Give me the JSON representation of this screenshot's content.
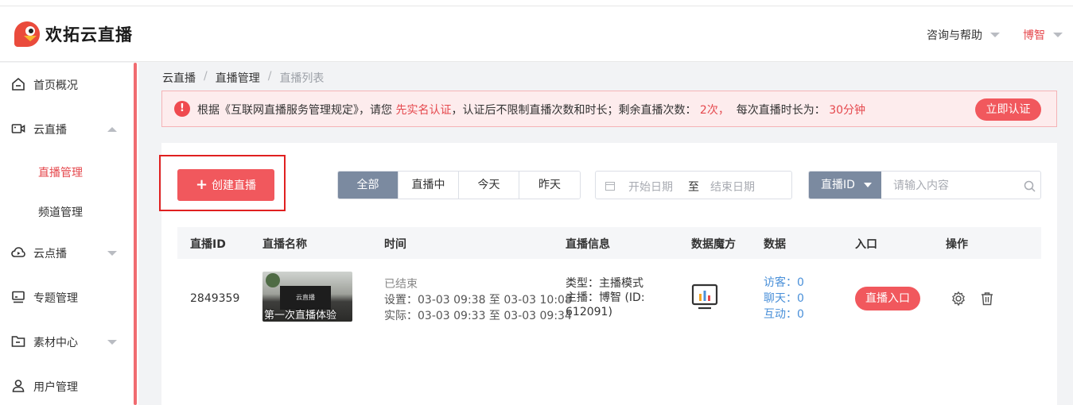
{
  "brand": {
    "name": "欢拓云直播",
    "accent": "#f1585d"
  },
  "header": {
    "help_label": "咨询与帮助",
    "user_name": "博智"
  },
  "sidebar": {
    "items": [
      {
        "label": "首页概况",
        "icon": "home-icon"
      },
      {
        "label": "云直播",
        "icon": "video-camera-icon"
      },
      {
        "label": "云点播",
        "icon": "cloud-play-icon"
      },
      {
        "label": "专题管理",
        "icon": "monitor-icon"
      },
      {
        "label": "素材中心",
        "icon": "folder-icon"
      },
      {
        "label": "用户管理",
        "icon": "user-icon"
      }
    ],
    "sub_items": [
      {
        "label": "直播管理",
        "active": true
      },
      {
        "label": "频道管理",
        "active": false
      }
    ]
  },
  "breadcrumb": {
    "items": [
      "云直播",
      "直播管理",
      "直播列表"
    ],
    "sep": "/"
  },
  "notice": {
    "icon_text": "!",
    "part1": "根据《互联网直播服务管理规定》，请您 ",
    "link": "先实名认证",
    "part2": "，认证后不限制直播次数和时长；剩余直播次数：",
    "remaining": "2次，",
    "part3": "  每次直播时长为：",
    "duration": "30分钟",
    "button": "立即认证"
  },
  "toolbar": {
    "create_label": "创建直播",
    "filters": [
      "全部",
      "直播中",
      "今天",
      "昨天"
    ],
    "active_filter": 0,
    "date_start_placeholder": "开始日期",
    "date_to": "至",
    "date_end_placeholder": "结束日期",
    "search_field": "直播ID",
    "search_placeholder": "请输入内容"
  },
  "table": {
    "columns": [
      "直播ID",
      "直播名称",
      "时间",
      "直播信息",
      "数据魔方",
      "数据",
      "入口",
      "操作"
    ],
    "rows": [
      {
        "id": "2849359",
        "name": "第一次直播体验",
        "thumb_screen_text": "云直播",
        "status": "已结束",
        "set_time": "设置：03-03 09:38 至 03-03 10:08",
        "actual_time": "实际：03-03 09:33 至 03-03 09:34",
        "type": "类型：主播模式",
        "host": "主播：博智 (ID:",
        "host_id": "612091)",
        "visitors": "访客：0",
        "chats": "聊天：0",
        "interactions": "互动：0",
        "entry_label": "直播入口"
      }
    ]
  }
}
